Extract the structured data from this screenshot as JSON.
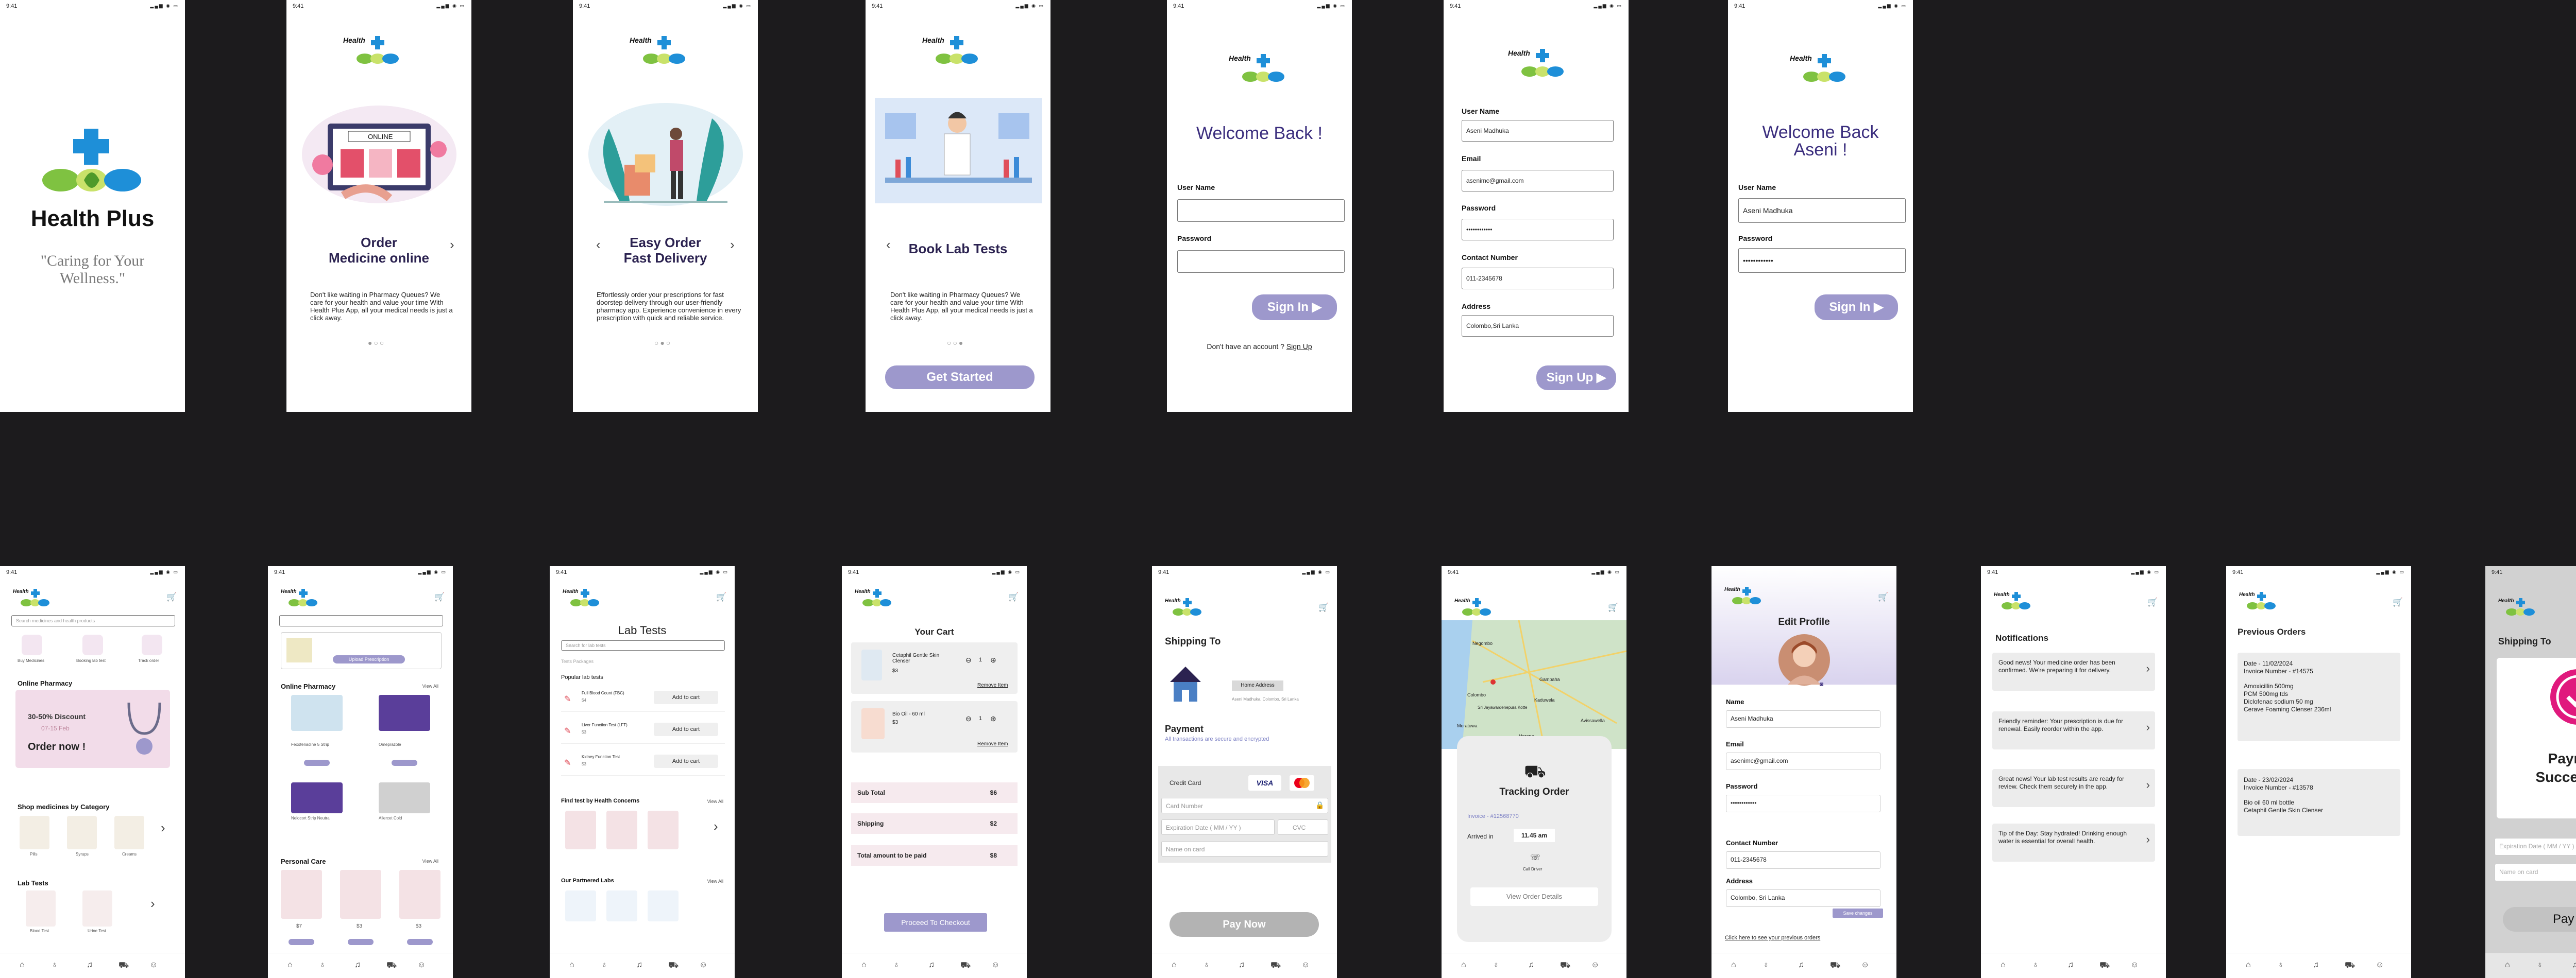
{
  "status_time": "9:41",
  "brand": {
    "name": "Health Plus",
    "tagline": "\"Caring for Your Wellness.\"",
    "short": "Health"
  },
  "onboarding": [
    {
      "title_line1": "Order",
      "title_line2": "Medicine online",
      "text": "Don't like waiting in Pharmacy Queues? We care for your health and value your time With Health Plus App, all your medical needs is just a click away."
    },
    {
      "title_line1": "Easy Order",
      "title_line2": "Fast Delivery",
      "text": "Effortlessly order your prescriptions for fast doorstep delivery through our user-friendly pharmacy app. Experience convenience in every prescription with quick and reliable service."
    },
    {
      "title_line1": "Book Lab Tests",
      "title_line2": "",
      "text": "Don't like waiting in Pharmacy Queues? We care for your health and value your time With Health Plus App, all your medical needs is just a click away.",
      "cta": "Get Started"
    }
  ],
  "signin": {
    "welcome": "Welcome Back !",
    "user_label": "User Name",
    "pass_label": "Password",
    "button": "Sign In",
    "no_account": "Don't have an account ?",
    "signup_link": "Sign Up"
  },
  "signup": {
    "user_label": "User Name",
    "user_value": "Aseni Madhuka",
    "email_label": "Email",
    "email_value": "asenimc@gmail.com",
    "pass_label": "Password",
    "pass_value": "••••••••••••",
    "contact_label": "Contact Number",
    "contact_value": "011-2345678",
    "address_label": "Address",
    "address_value": "Colombo,Sri Lanka",
    "button": "Sign Up"
  },
  "signin_filled": {
    "welcome_line1": "Welcome Back",
    "welcome_line2": "Aseni !",
    "user_label": "User Name",
    "user_value": "Aseni Madhuka",
    "pass_label": "Password",
    "pass_value": "••••••••••••",
    "button": "Sign In"
  },
  "home": {
    "search_placeholder": "Search medicines and health products",
    "quick": [
      "Buy Medicines",
      "Booking lab test",
      "Track order"
    ],
    "online_pharmacy": "Online Pharmacy",
    "promo_line1": "30-50% Discount",
    "promo_line2": "07-15 Feb",
    "promo_cta": "Order now !",
    "shop_category": "Shop medicines by Category",
    "categories": [
      "Pills",
      "Syrups",
      "Creams"
    ],
    "lab_tests": "Lab Tests",
    "labs": [
      "Blood Test",
      "Urine Test"
    ]
  },
  "pharmacy": {
    "online_pharmacy": "Online Pharmacy",
    "view_all": "View All",
    "upload": "Upload Prescription",
    "products": [
      "Fexofenadine 5 Strip",
      "Omeprazole",
      "Nelocort Strip Neutra",
      "Allercet Cold"
    ],
    "personal_care": "Personal Care",
    "prices": [
      "$7",
      "$3",
      "$3"
    ]
  },
  "labtests": {
    "title": "Lab Tests",
    "search_placeholder": "Search for lab tests",
    "tabs": "Tests Packages",
    "popular": "Popular lab tests",
    "tests": [
      {
        "name": "Full Blood Count (FBC)",
        "price": "$4"
      },
      {
        "name": "Liver Function Test (LFT)",
        "price": "$3"
      },
      {
        "name": "Kidney Function Test",
        "price": "$3"
      }
    ],
    "add": "Add to cart",
    "health_concerns": "Find test by Health Concerns",
    "view_all": "View All",
    "partners": "Our Partnered Labs"
  },
  "cart": {
    "title": "Your Cart",
    "items": [
      {
        "name": "Cetaphil Gentle Skin Clenser",
        "price": "$3",
        "qty": "1"
      },
      {
        "name": "Bio Oil - 60 ml",
        "price": "$3",
        "qty": "1"
      }
    ],
    "remove": "Remove Item",
    "subtotal_label": "Sub Total",
    "subtotal": "$6",
    "shipping_label": "Shipping",
    "shipping": "$2",
    "total_label": "Total amount to be paid",
    "total": "$8",
    "checkout": "Proceed To Checkout"
  },
  "shipping": {
    "title": "Shipping To",
    "home": "Home Address",
    "address": "Aseni Madhuka, Colombo, Sri Lanka",
    "payment": "Payment",
    "secure": "All transactions are secure and encrypted",
    "credit_card": "Credit Card",
    "visa": "VISA",
    "card_number": "Card Number",
    "expiry": "Expiration Date ( MM / YY )",
    "cvc": "CVC",
    "name_on_card": "Name on card",
    "pay": "Pay Now"
  },
  "tracking": {
    "title": "Tracking Order",
    "invoice": "Invoice - #12568770",
    "arrived": "Arrived in",
    "time": "11.45 am",
    "driver": "Call Driver",
    "details": "View Order Details",
    "map_labels": [
      "Negombo",
      "Gampaha",
      "Colombo",
      "Sri Jayawardenepura Kotte",
      "Kaduwela",
      "Moratuwa",
      "Horana",
      "Avissawella"
    ]
  },
  "profile": {
    "title": "Edit Profile",
    "name_label": "Name",
    "name_value": "Aseni Madhuka",
    "email_label": "Email",
    "email_value": "asenimc@gmail.com",
    "pass_label": "Password",
    "pass_value": "••••••••••••",
    "contact_label": "Contact Number",
    "contact_value": "011-2345678",
    "address_label": "Address",
    "address_value": "Colombo, Sri Lanka",
    "save": "Save changes",
    "prev_link": "Click here to see your previous orders"
  },
  "notifications": {
    "title": "Notifications",
    "items": [
      "Good news! Your medicine order has been confirmed. We're preparing it for delivery.",
      "Friendly reminder: Your prescription is due for renewal. Easily reorder within the app.",
      "Great news! Your lab test results are ready for review. Check them securely in the app.",
      "Tip of the Day: Stay hydrated! Drinking enough water is essential for overall health."
    ]
  },
  "orders": {
    "title": "Previous Orders",
    "list": [
      {
        "date": "Date - 11/02/2024",
        "invoice": "Invoice Number - #14575",
        "items": [
          "Amoxicillin 500mg",
          "PCM 500mg tds",
          "Diclofenac sodium 50 mg",
          "Cerave Foaming Clenser 236ml"
        ]
      },
      {
        "date": "Date - 23/02/2024",
        "invoice": "Invoice Number - #13578",
        "items": [
          "Bio oil 60 ml bottle",
          "Cetaphil Gentle Skin Clenser"
        ]
      }
    ]
  },
  "success": {
    "title": "Shipping To",
    "message_line1": "Payment",
    "message_line2": "Successful !",
    "pay": "Pay Now"
  },
  "colors": {
    "accent": "#9d98cc",
    "navy": "#2b2250",
    "green": "#7fc241",
    "blue": "#1e8fd8",
    "pink": "#e0197d"
  }
}
